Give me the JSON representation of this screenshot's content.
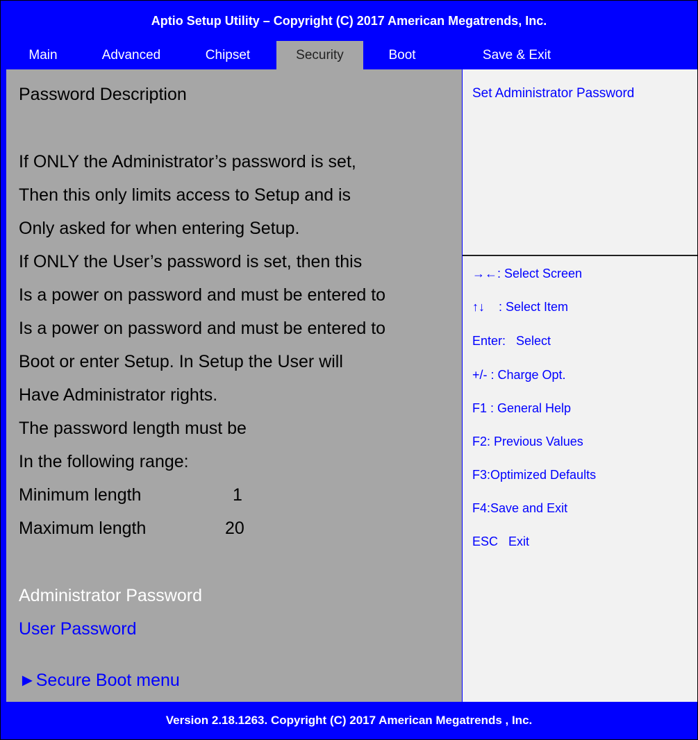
{
  "window": {
    "title": "Aptio Setup Utility – Copyright (C) 2017 American Megatrends, Inc."
  },
  "tabs": [
    {
      "label": "Main"
    },
    {
      "label": "Advanced"
    },
    {
      "label": "Chipset"
    },
    {
      "label": "Security",
      "active": true
    },
    {
      "label": "Boot"
    },
    {
      "label": "Save & Exit"
    }
  ],
  "main": {
    "description_heading": "Password Description",
    "description_lines": [
      "If ONLY the Administrator’s password is set,",
      "Then this only limits access to Setup and is",
      "Only asked for when entering Setup.",
      "If ONLY the User’s password is set, then this",
      "Is a power on password and must be entered to",
      "Is a power on password and must be entered to",
      "Boot or enter Setup. In Setup the User will",
      "Have Administrator rights.",
      "The password length must be",
      "In the following range:"
    ],
    "min_length_label": "Minimum length",
    "min_length_value": "1",
    "max_length_label": "Maximum length",
    "max_length_value": "20",
    "items": {
      "admin_password": "Administrator Password",
      "user_password": "User Password",
      "secure_boot_arrow": "►",
      "secure_boot": "Secure Boot menu"
    }
  },
  "help": {
    "item_help": "Set Administrator Password",
    "keys": [
      "→←: Select Screen",
      "↑↓    : Select Item",
      "Enter:   Select",
      "+/- : Charge Opt.",
      "F1 : General Help",
      "F2: Previous Values",
      "F3:Optimized Defaults",
      "F4:Save and Exit",
      "ESC   Exit"
    ]
  },
  "footer": {
    "text": "Version 2.18.1263. Copyright (C) 2017 American Megatrends , Inc."
  },
  "colors": {
    "bios_blue": "#0000ff",
    "panel_gray": "#a6a6a6",
    "help_panel": "#f2f2f2",
    "highlight_text": "#ffffff"
  }
}
